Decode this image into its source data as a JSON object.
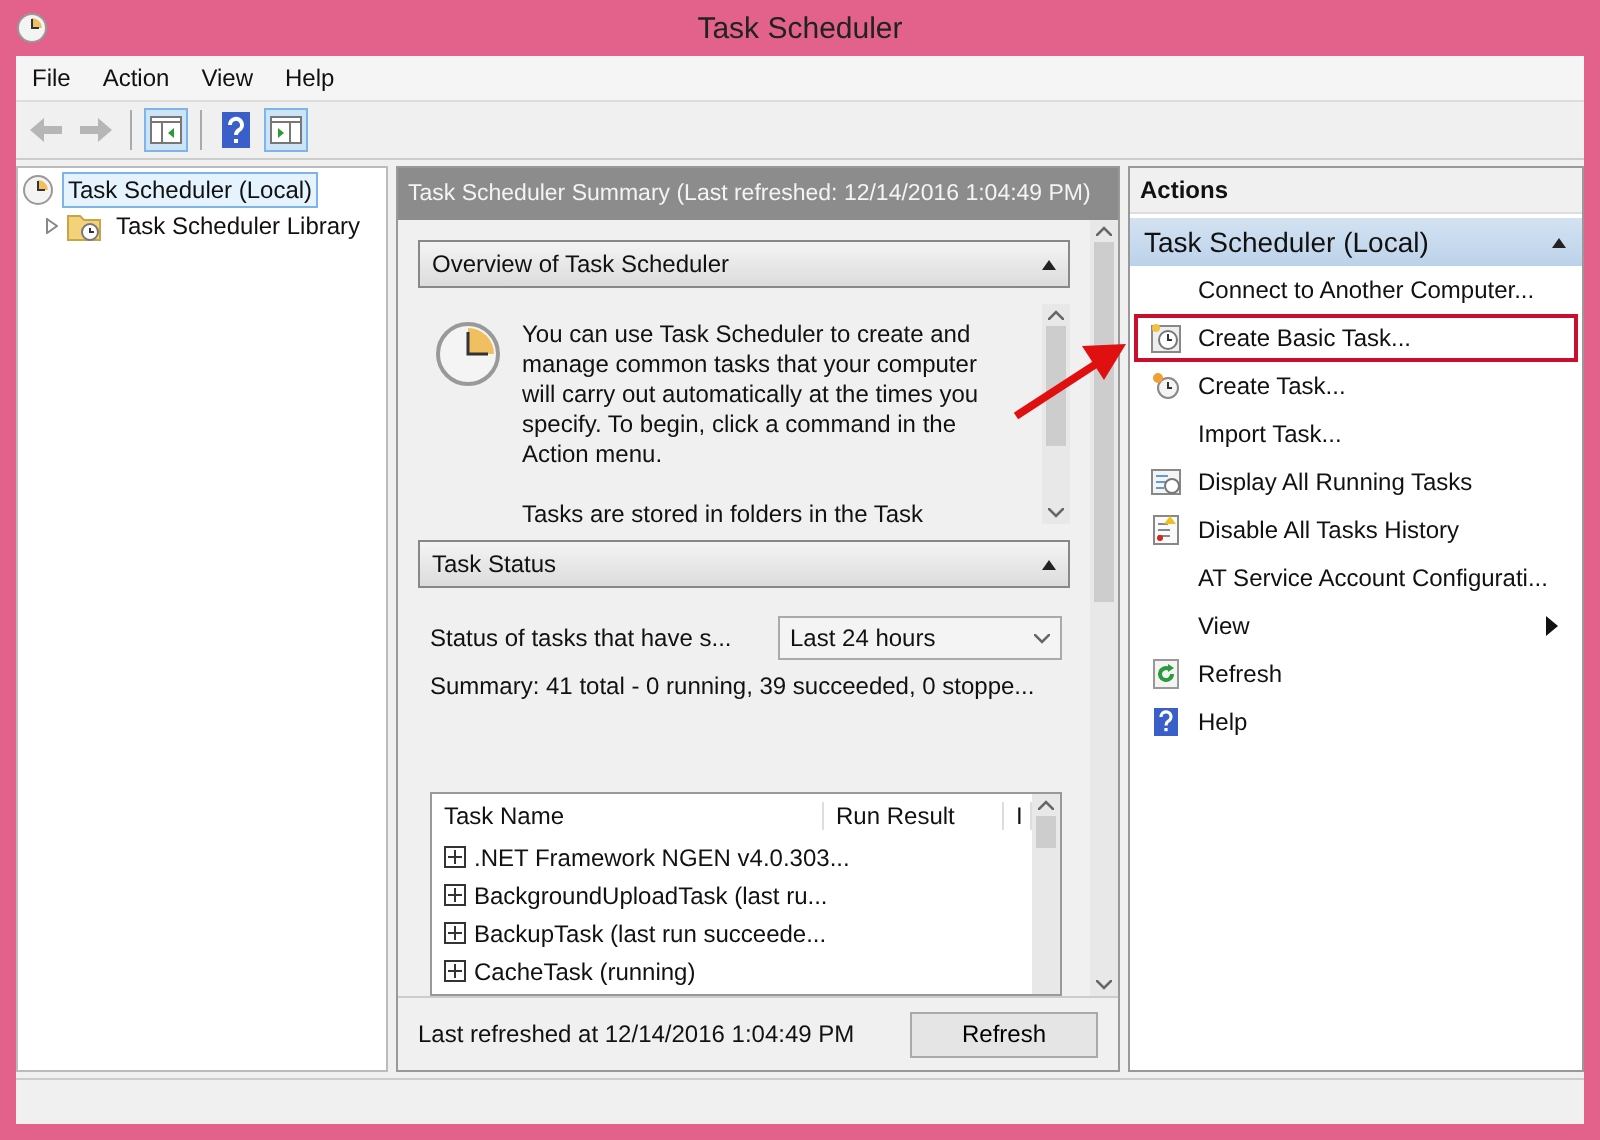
{
  "window": {
    "title": "Task Scheduler"
  },
  "menu": [
    "File",
    "Action",
    "View",
    "Help"
  ],
  "toolbar": [
    {
      "kind": "back",
      "disabled": true,
      "pressed": false
    },
    {
      "kind": "forward",
      "disabled": true,
      "pressed": false
    },
    {
      "kind": "tree-pane",
      "disabled": false,
      "pressed": true
    },
    {
      "kind": "help",
      "disabled": false,
      "pressed": false
    },
    {
      "kind": "action-pane",
      "disabled": false,
      "pressed": true
    }
  ],
  "tree": [
    {
      "label": "Task Scheduler (Local)",
      "selected": true,
      "children": [
        {
          "label": "Task Scheduler Library",
          "selected": false,
          "expanded": false
        }
      ]
    }
  ],
  "summary": {
    "header": "Task Scheduler Summary (Last refreshed: 12/14/2016 1:04:49 PM)",
    "overview": {
      "title": "Overview of Task Scheduler",
      "expanded": true,
      "paragraphs": [
        "You can use Task Scheduler to create and manage common tasks that your computer will carry out automatically at the times you specify. To begin, click a command in the Action menu.",
        "Tasks are stored in folders in the Task"
      ]
    },
    "status": {
      "title": "Task Status",
      "expanded": true,
      "filter_label": "Status of tasks that have s...",
      "filter_value": "Last 24 hours",
      "summary": "Summary: 41 total - 0 running, 39 succeeded, 0 stoppe...",
      "columns": [
        "Task Name",
        "Run Result",
        "I"
      ],
      "rows": [
        ".NET Framework NGEN v4.0.303...",
        "BackgroundUploadTask (last ru...",
        "BackupTask (last run succeede...",
        "CacheTask (running)"
      ]
    },
    "footer": {
      "text": "Last refreshed at 12/14/2016 1:04:49 PM",
      "button": "Refresh"
    }
  },
  "actions": {
    "title": "Actions",
    "group": "Task Scheduler (Local)",
    "expanded": true,
    "items": [
      {
        "label": "Connect to Another Computer...",
        "highlighted": false,
        "submenu": false
      },
      {
        "label": "Create Basic Task...",
        "highlighted": true,
        "submenu": false
      },
      {
        "label": "Create Task...",
        "highlighted": false,
        "submenu": false
      },
      {
        "label": "Import Task...",
        "highlighted": false,
        "submenu": false
      },
      {
        "label": "Display All Running Tasks",
        "highlighted": false,
        "submenu": false
      },
      {
        "label": "Disable All Tasks History",
        "highlighted": false,
        "submenu": false
      },
      {
        "label": "AT Service Account Configurati...",
        "highlighted": false,
        "submenu": false
      },
      {
        "label": "View",
        "highlighted": false,
        "submenu": true
      },
      {
        "label": "Refresh",
        "highlighted": false,
        "submenu": false
      },
      {
        "label": "Help",
        "highlighted": false,
        "submenu": false
      }
    ]
  }
}
